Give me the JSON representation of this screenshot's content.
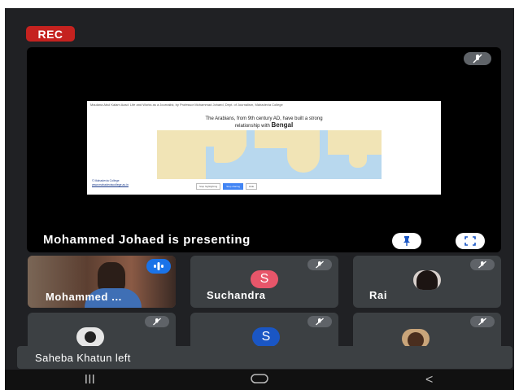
{
  "recording": {
    "badge": "REC"
  },
  "presentation": {
    "banner": "Mohammed Johaed is presenting",
    "slide": {
      "top_line": "Maulana Abul Kalam Azad: Life and Works as a Journalist, by Professor Mohammad Johaed, Dept. of Journalism, Mahadevia College",
      "heading_line1": "The Arabians, from 9th century AD, have built a strong",
      "heading_line2_prefix": "relationship with ",
      "heading_line2_bold": "Bengal",
      "footer_line1": "© Mahadevia College",
      "footer_line2": "www.mahadeviacollege.ac.in",
      "button_left": "Stop highlighting",
      "button_blue": "Stop sharing",
      "button_right": "Hide"
    }
  },
  "participants": [
    {
      "name": "Mohammed ...",
      "type": "video",
      "speaking": true
    },
    {
      "name": "Suchandra",
      "type": "initial",
      "initial": "S",
      "color": "#e8566a"
    },
    {
      "name": "Rai",
      "type": "photo"
    },
    {
      "name": "",
      "type": "photo"
    },
    {
      "name": "",
      "type": "initial",
      "initial": "S",
      "color": "#1a56c4"
    },
    {
      "name": "",
      "type": "photo"
    }
  ],
  "toast": {
    "message": "Saheba Khatun left"
  },
  "navbar": {
    "recents": "III",
    "home": "○",
    "back": "<"
  },
  "icons": {
    "mic_off": "mic-off-icon",
    "pin": "pin-icon",
    "fullscreen": "fullscreen-icon",
    "speaking": "audio-level-icon"
  }
}
